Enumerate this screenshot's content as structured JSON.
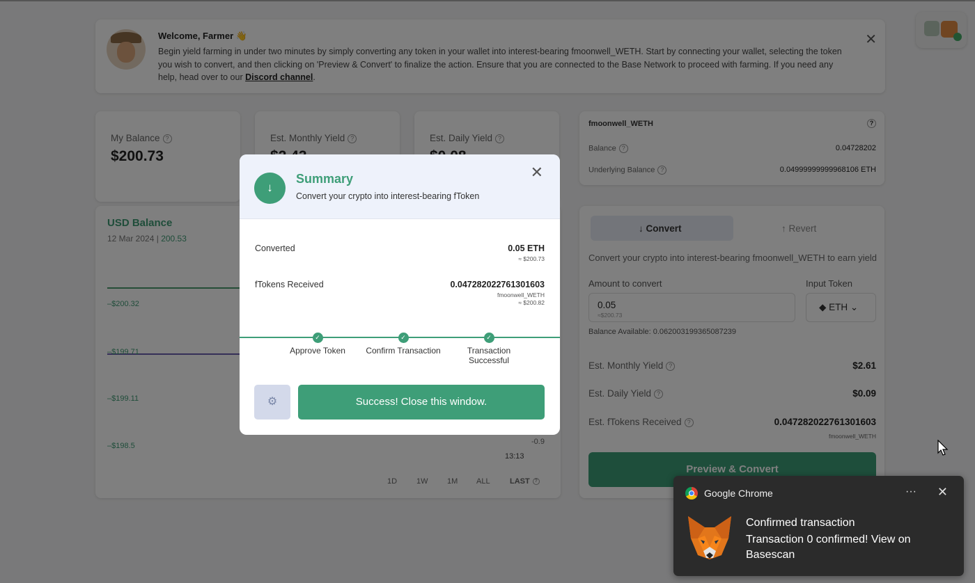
{
  "welcome": {
    "title": "Welcome, Farmer 👋",
    "text": "Begin yield farming in under two minutes by simply converting any token in your wallet into interest-bearing fmoonwell_WETH. Start by connecting your wallet, selecting the token you wish to convert, and then clicking on 'Preview & Convert' to finalize the action. Ensure that you are connected to the Base Network to proceed with farming. If you need any help, head over to our ",
    "link": "Discord channel",
    "after_link": "."
  },
  "stats": [
    {
      "label": "My Balance",
      "value": "$200.73"
    },
    {
      "label": "Est. Monthly Yield",
      "value": "$2.43"
    },
    {
      "label": "Est. Daily Yield",
      "value": "$0.08"
    }
  ],
  "chart": {
    "title": "USD Balance",
    "date": "12 Mar 2024",
    "value": "200.53",
    "y_labels": [
      "$200.32",
      "$199.71",
      "$199.11",
      "$198.5"
    ],
    "right_label": "-0.9",
    "time_label": "13:13",
    "ranges": [
      "1D",
      "1W",
      "1M",
      "ALL",
      "LAST"
    ]
  },
  "token_info": {
    "name": "fmoonwell_WETH",
    "balance_label": "Balance",
    "balance": "0.04728202",
    "underlying_label": "Underlying Balance",
    "underlying": "0.04999999999968106 ETH"
  },
  "convert": {
    "tab_convert": "Convert",
    "tab_revert": "Revert",
    "note": "Convert your crypto into interest-bearing fmoonwell_WETH to earn yield",
    "amount_label": "Amount to convert",
    "input_label": "Input Token",
    "amount": "0.05",
    "amount_usd": "≈$200.73",
    "token": "ETH",
    "balance_available": "Balance Available:  0.062003199365087239",
    "monthly_label": "Est. Monthly Yield",
    "monthly": "$2.61",
    "daily_label": "Est. Daily Yield",
    "daily": "$0.09",
    "ftokens_label": "Est. fTokens Received",
    "ftokens": "0.047282022761301603",
    "ftokens_unit": "fmoonwell_WETH",
    "button": "Preview & Convert"
  },
  "modal": {
    "title": "Summary",
    "subtitle": "Convert your crypto into interest-bearing fToken",
    "converted_label": "Converted",
    "converted": "0.05 ETH",
    "converted_usd": "≈ $200.73",
    "received_label": "fTokens Received",
    "received": "0.047282022761301603",
    "received_unit": "fmoonwell_WETH",
    "received_usd": "≈ $200.82",
    "steps": [
      "Approve Token",
      "Confirm Transaction",
      "Transaction Successful"
    ],
    "success_button": "Success! Close this window."
  },
  "notification": {
    "app": "Google Chrome",
    "title": "Confirmed transaction",
    "body": "Transaction 0 confirmed! View on Basescan"
  },
  "colors": {
    "accent": "#3e9e78",
    "overlay": "rgba(0,0,0,0.5)",
    "toast_bg": "#2b2b2b"
  }
}
